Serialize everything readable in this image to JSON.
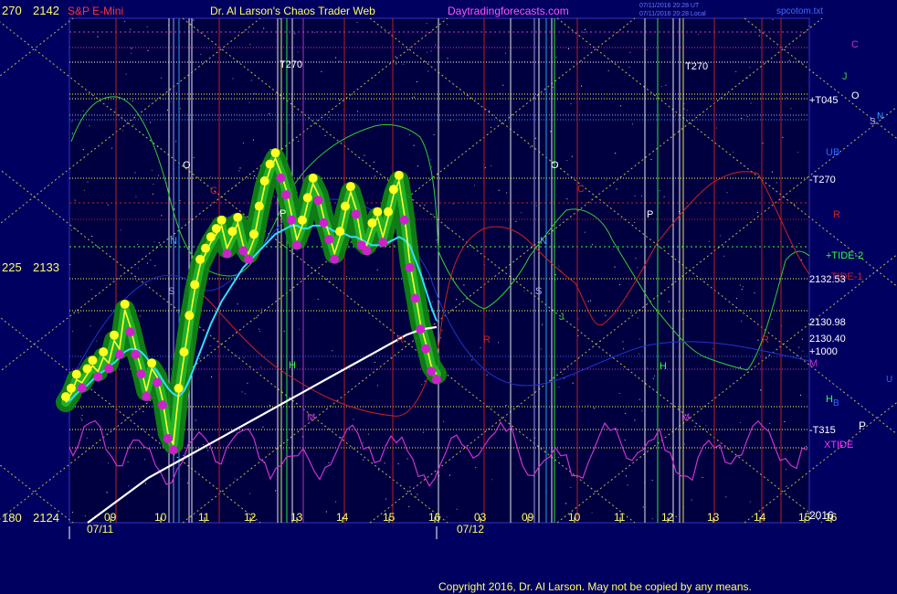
{
  "header": {
    "axis_top_left": "270",
    "price_top_left": "2142",
    "instrument": "S&P E-Mini",
    "author_title": "Dr. Al Larson's Chaos Trader Web",
    "site": "Daytradingforecasts.com",
    "timestamp_line1": "07/11/2016 20:28 UT",
    "timestamp_line2": "07/11/2016 20:28 Local",
    "file_name": "spcotom.txt"
  },
  "left_axis": {
    "mid_angle": "225",
    "mid_price": "2133",
    "bottom_angle": "180",
    "bottom_price": "2124"
  },
  "right_labels": [
    {
      "text": "C",
      "color": "#cc33cc"
    },
    {
      "text": "J",
      "color": "#33cc33"
    },
    {
      "text": "O",
      "color": "#ffffff"
    },
    {
      "text": "+T045",
      "color": "#ffffff"
    },
    {
      "text": "N",
      "color": "#33aaff"
    },
    {
      "text": "S",
      "color": "#aaaaff"
    },
    {
      "text": "UB",
      "color": "#3366ff"
    },
    {
      "text": "-T270",
      "color": "#ffffff"
    },
    {
      "text": "R",
      "color": "#cc2222"
    },
    {
      "text": "+TIDE-2",
      "color": "#33ff33"
    },
    {
      "text": "-TIDE-1",
      "color": "#cc2222"
    },
    {
      "text": "2132.53",
      "color": "#ffffff"
    },
    {
      "text": "2130.98",
      "color": "#ffffff"
    },
    {
      "text": "2130.40",
      "color": "#ffffff"
    },
    {
      "text": "+1000",
      "color": "#ffffff"
    },
    {
      "text": "M",
      "color": "#cc33cc"
    },
    {
      "text": "U",
      "color": "#3366ff"
    },
    {
      "text": "H",
      "color": "#33ff33"
    },
    {
      "text": "B",
      "color": "#3366ff"
    },
    {
      "text": "-T315",
      "color": "#ffffff"
    },
    {
      "text": "P",
      "color": "#ffffff"
    },
    {
      "text": "XTIDE",
      "color": "#ff33ff"
    },
    {
      "text": "2016",
      "color": "#ffffff"
    }
  ],
  "chart_labels": [
    {
      "text": "T270",
      "color": "#ffffff"
    },
    {
      "text": "T270",
      "color": "#ffffff"
    },
    {
      "text": "O",
      "color": "#ffffff"
    },
    {
      "text": "O",
      "color": "#ffffff"
    },
    {
      "text": "C",
      "color": "#cc2222"
    },
    {
      "text": "C",
      "color": "#cc2222"
    },
    {
      "text": "N",
      "color": "#33aaff"
    },
    {
      "text": "N",
      "color": "#33aaff"
    },
    {
      "text": "S",
      "color": "#aaaaff"
    },
    {
      "text": "S",
      "color": "#aaaaff"
    },
    {
      "text": "P",
      "color": "#ffffff"
    },
    {
      "text": "P",
      "color": "#ffffff"
    },
    {
      "text": "J",
      "color": "#33cc33"
    },
    {
      "text": "R",
      "color": "#cc2222"
    },
    {
      "text": "R",
      "color": "#cc2222"
    },
    {
      "text": "R",
      "color": "#cc2222"
    },
    {
      "text": "H",
      "color": "#33ff33"
    },
    {
      "text": "H",
      "color": "#33ff33"
    },
    {
      "text": "M",
      "color": "#cc33cc"
    },
    {
      "text": "M",
      "color": "#cc33cc"
    }
  ],
  "footer": {
    "date1": "07/11",
    "date2": "07/12",
    "copyright": "Copyright 2016, Dr. Al Larson. May not be copied by any means."
  },
  "chart_data": {
    "type": "line",
    "ylim": [
      2124,
      2142
    ],
    "x_ticks": [
      "09",
      "10",
      "11",
      "12",
      "13",
      "14",
      "15",
      "16",
      "03",
      "09",
      "10",
      "11",
      "12",
      "13",
      "14",
      "15",
      "16"
    ],
    "price_levels": [
      {
        "label": "2132.53",
        "value": 2132.53
      },
      {
        "label": "2130.98",
        "value": 2130.98
      },
      {
        "label": "2130.40",
        "value": 2130.4
      }
    ],
    "series": [
      {
        "values": [
          2128.3,
          2128.6,
          2129.1,
          2129.0,
          2129.3,
          2129.6,
          2129.4,
          2129.9,
          2129.7,
          2130.5,
          2130.2,
          2131.6,
          2131.0,
          2130.2,
          2129.5,
          2128.7,
          2129.5,
          2129.2,
          2128.4,
          2127.2,
          2126.8,
          2128.6,
          2129.9,
          2131.2,
          2132.3,
          2133.2,
          2133.6,
          2134.0,
          2134.3,
          2134.6,
          2133.8,
          2134.2,
          2134.7,
          2133.9,
          2133.6,
          2134.1,
          2135.1,
          2136.0,
          2136.6,
          2137.0,
          2136.5,
          2135.9,
          2135.0,
          2134.1,
          2134.6,
          2135.4,
          2136.1,
          2135.7,
          2134.9,
          2134.3,
          2133.6,
          2134.2,
          2135.1,
          2135.8,
          2135.2,
          2134.1,
          2133.9,
          2134.5,
          2134.9,
          2134.2,
          2134.9,
          2135.7,
          2136.2,
          2135.0,
          2133.3,
          2132.2,
          2131.1,
          2130.4,
          2129.6,
          2129.3
        ]
      },
      {
        "values": [
          2128.3,
          2128.4,
          2128.6,
          2128.8,
          2128.9,
          2129.1,
          2129.3,
          2129.4,
          2129.6,
          2129.7,
          2129.9,
          2130.1,
          2130.2,
          2130.2,
          2130.1,
          2129.9,
          2129.6,
          2129.4,
          2129.1,
          2128.8,
          2128.6,
          2128.5,
          2128.7,
          2129.1,
          2129.6,
          2130.1,
          2130.6,
          2131.1,
          2131.5,
          2131.9,
          2132.2,
          2132.5,
          2132.8,
          2133.1,
          2133.3,
          2133.5,
          2133.7,
          2133.9,
          2134.1,
          2134.3,
          2134.4,
          2134.5,
          2134.6,
          2134.6,
          2134.5,
          2134.5,
          2134.6,
          2134.6,
          2134.6,
          2134.5,
          2134.4,
          2134.3,
          2134.3,
          2134.2,
          2134.2,
          2134.1,
          2134.0,
          2133.9,
          2133.9,
          2133.9,
          2134.0,
          2134.1,
          2134.2,
          2134.1,
          2133.9,
          2133.4,
          2132.9,
          2132.3,
          2131.7,
          2131.2
        ]
      },
      {
        "values": [
          2124.0,
          2124.4,
          2124.8,
          2125.2,
          2125.6,
          2125.9,
          2126.2,
          2126.5,
          2126.8,
          2127.1,
          2127.4,
          2127.7,
          2128.0,
          2128.3,
          2128.6,
          2128.9,
          2129.2,
          2129.5,
          2129.8,
          2130.1,
          2130.4,
          2130.7,
          2130.9,
          2130.98
        ]
      }
    ]
  }
}
